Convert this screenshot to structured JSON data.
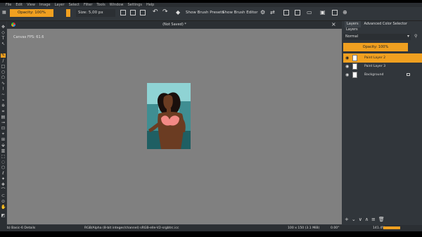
{
  "menu": [
    "File",
    "Edit",
    "View",
    "Image",
    "Layer",
    "Select",
    "Filter",
    "Tools",
    "Window",
    "Settings",
    "Help"
  ],
  "toolbar": {
    "opacity_label": "Opacity: 100%",
    "size_label": "Size: 5,00 px",
    "show_brush_presets": "Show Brush Presets",
    "show_brush_editor": "Show Brush Editor"
  },
  "document": {
    "title": "(Not Saved)",
    "fps": "Canvas FPS: 61.6"
  },
  "docker": {
    "tabs": [
      "Layers",
      "Advanced Color Selector"
    ],
    "title": "Layers",
    "blend_mode": "Normal",
    "opacity": "Opacity: 100%",
    "layers": [
      {
        "name": "Paint Layer 2",
        "selected": true
      },
      {
        "name": "Paint Layer 3",
        "selected": false
      },
      {
        "name": "Background",
        "selected": false
      }
    ]
  },
  "status": {
    "brush": "b) Basic-6 Details",
    "color_model": "RGB/Alpha (8-bit integer/channel)  sRGB-elle-V2-srgbtrc.icc",
    "dimensions": "100 x 150 (3.1 MiB)",
    "rotation": "0.00°",
    "zoom": "141.4%"
  },
  "colors": {
    "accent": "#f0a020",
    "canvas": "#808080",
    "panel": "#31363b"
  }
}
